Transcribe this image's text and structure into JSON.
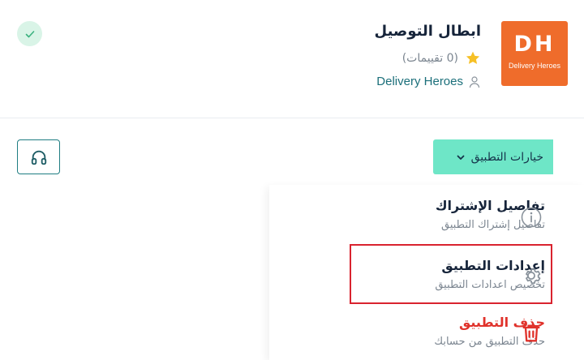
{
  "app": {
    "name": "ابطال التوصيل",
    "logo_mark": "DH",
    "logo_text": "Delivery Heroes",
    "rating_text": "(0 تقييمات)",
    "developer": "Delivery Heroes",
    "logo_color": "#ef6c2b"
  },
  "verified": {
    "icon": "check-icon",
    "color": "#3bb27f"
  },
  "support": {
    "icon": "headset-icon"
  },
  "options": {
    "label": "خيارات التطبيق",
    "accent": "#6ee6c7"
  },
  "menu": {
    "items": [
      {
        "title": "تفاصيل الإشتراك",
        "subtitle": "تفاصيل إشتراك التطبيق",
        "icon": "info-icon"
      },
      {
        "title": "إعدادات التطبيق",
        "subtitle": "تخصيص اعدادات التطبيق",
        "icon": "gear-icon"
      },
      {
        "title": "حذف التطبيق",
        "subtitle": "حذف التطبيق من حسابك",
        "icon": "trash-icon",
        "color": "#e0322b"
      }
    ]
  }
}
